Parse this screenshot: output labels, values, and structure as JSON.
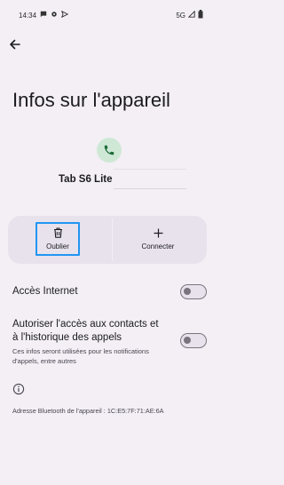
{
  "status_bar": {
    "time": "14:34",
    "network": "5G",
    "left_icons": [
      "chat-icon",
      "gear-icon",
      "send-icon"
    ],
    "right_icons": [
      "signal-icon",
      "battery-icon"
    ]
  },
  "header": {
    "back_icon": "arrow-left-icon"
  },
  "page": {
    "title": "Infos sur l'appareil"
  },
  "device": {
    "icon": "phone-icon",
    "icon_bg": "#cfe8d6",
    "name": "Tab S6 Lite"
  },
  "actions": {
    "forget_label": "Oublier",
    "forget_icon": "trash-icon",
    "connect_label": "Connecter",
    "connect_icon": "plus-icon"
  },
  "settings": {
    "internet": {
      "label": "Accès Internet",
      "enabled": false
    },
    "contacts": {
      "label_line1": "Autoriser l'accès aux contacts et",
      "label_line2": "à l'historique des appels",
      "sub_line1": "Ces infos seront utilisées pour les notifications",
      "sub_line2": "d'appels, entre autres",
      "enabled": false
    }
  },
  "footer": {
    "info_icon": "info-icon",
    "bt_address": "Adresse Bluetooth de l'appareil : 1C:E5:7F:71:AE:6A"
  },
  "colors": {
    "background": "#f3eff5",
    "panel": "#e7e2ec",
    "highlight": "#2196f3",
    "accent_green": "#1e6b3a"
  }
}
